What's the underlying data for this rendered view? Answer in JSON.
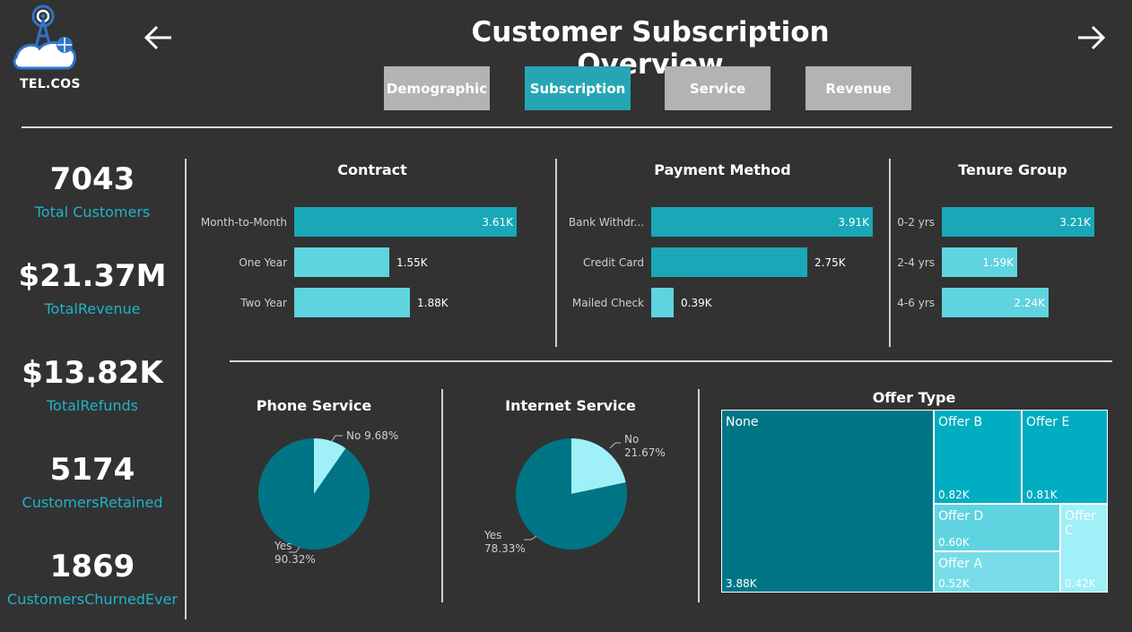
{
  "header": {
    "brand": "TEL.COS",
    "title": "Customer Subscription Overview",
    "tabs": [
      "Demographic",
      "Subscription",
      "Service",
      "Revenue"
    ],
    "active_tab": 1
  },
  "kpis": [
    {
      "value": "7043",
      "label": "Total Customers"
    },
    {
      "value": "$21.37M",
      "label": "TotalRevenue"
    },
    {
      "value": "$13.82K",
      "label": "TotalRefunds"
    },
    {
      "value": "5174",
      "label": "CustomersRetained"
    },
    {
      "value": "1869",
      "label": "CustomersChurnedEver"
    }
  ],
  "colors": {
    "dark_teal": "#007585",
    "teal": "#1aa7b8",
    "light_teal": "#5fd3df",
    "pale_teal": "#9ff0f7",
    "accent": "#26a6b5"
  },
  "chart_data": [
    {
      "type": "bar",
      "orientation": "horizontal",
      "title": "Contract",
      "categories": [
        "Month-to-Month",
        "One Year",
        "Two Year"
      ],
      "values": [
        3.61,
        1.55,
        1.88
      ],
      "labels": [
        "3.61K",
        "1.55K",
        "1.88K"
      ],
      "unit": "K",
      "xlim": [
        0,
        3.61
      ]
    },
    {
      "type": "bar",
      "orientation": "horizontal",
      "title": "Payment Method",
      "categories": [
        "Bank Withdr...",
        "Credit Card",
        "Mailed Check"
      ],
      "values": [
        3.91,
        2.75,
        0.39
      ],
      "labels": [
        "3.91K",
        "2.75K",
        "0.39K"
      ],
      "unit": "K",
      "xlim": [
        0,
        3.91
      ]
    },
    {
      "type": "bar",
      "orientation": "horizontal",
      "title": "Tenure Group",
      "categories": [
        "0-2 yrs",
        "2-4 yrs",
        "4-6 yrs"
      ],
      "values": [
        3.21,
        1.59,
        2.24
      ],
      "labels": [
        "3.21K",
        "1.59K",
        "2.24K"
      ],
      "unit": "K",
      "xlim": [
        0,
        3.21
      ]
    },
    {
      "type": "pie",
      "title": "Phone Service",
      "slices": [
        {
          "name": "No",
          "value": 9.68,
          "label": "No 9.68%"
        },
        {
          "name": "Yes",
          "value": 90.32,
          "label": "Yes 90.32%"
        }
      ]
    },
    {
      "type": "pie",
      "title": "Internet Service",
      "slices": [
        {
          "name": "No",
          "value": 21.67,
          "label": "No 21.67%"
        },
        {
          "name": "Yes",
          "value": 78.33,
          "label": "Yes 78.33%"
        }
      ]
    },
    {
      "type": "treemap",
      "title": "Offer Type",
      "items": [
        {
          "name": "None",
          "value": 3.88,
          "label": "3.88K"
        },
        {
          "name": "Offer B",
          "value": 0.82,
          "label": "0.82K"
        },
        {
          "name": "Offer E",
          "value": 0.81,
          "label": "0.81K"
        },
        {
          "name": "Offer D",
          "value": 0.6,
          "label": "0.60K"
        },
        {
          "name": "Offer A",
          "value": 0.52,
          "label": "0.52K"
        },
        {
          "name": "Offer C",
          "value": 0.42,
          "label": "0.42K"
        }
      ]
    }
  ]
}
